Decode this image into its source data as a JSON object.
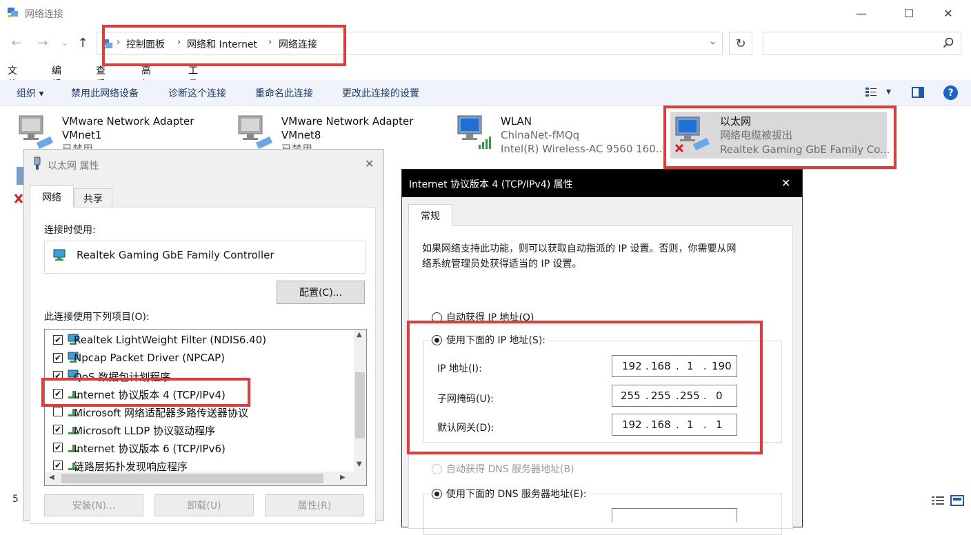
{
  "window": {
    "title": "网络连接",
    "controls": {
      "minimize": "—",
      "maximize": "☐",
      "close": "✕"
    }
  },
  "nav": {
    "back": "←",
    "forward": "→",
    "recent": "⌄",
    "up": "↑",
    "breadcrumbs": [
      "控制面板",
      "网络和 Internet",
      "网络连接"
    ],
    "dropdown": "⌄",
    "refresh": "↻",
    "search_placeholder": ""
  },
  "menubar": [
    "文件(F)",
    "编辑(E)",
    "查看(V)",
    "高级(N)",
    "工具(T)"
  ],
  "commandbar": {
    "organize": "组织 ▾",
    "commands": [
      "禁用此网络设备",
      "诊断这个连接",
      "重命名此连接",
      "更改此连接的设置"
    ],
    "view_dropdown": "▾",
    "help": "?"
  },
  "adapters": [
    {
      "name": "VMware Network Adapter",
      "name2": "VMnet1",
      "status": "已禁用",
      "device": ""
    },
    {
      "name": "VMware Network Adapter",
      "name2": "VMnet8",
      "status": "已禁用",
      "device": ""
    },
    {
      "name": "WLAN",
      "name2": "",
      "status": "ChinaNet-fMQq",
      "device": "Intel(R) Wireless-AC 9560 160..."
    },
    {
      "name": "以太网",
      "name2": "",
      "status": "网络电缆被拔出",
      "device": "Realtek Gaming GbE Family Co..."
    }
  ],
  "statusbar": {
    "count": "5"
  },
  "props_dialog": {
    "title": "以太网 属性",
    "close": "✕",
    "tabs": [
      "网络",
      "共享"
    ],
    "connect_using_label": "连接时使用:",
    "adapter_name": "Realtek Gaming GbE Family Controller",
    "configure_button": "配置(C)...",
    "items_label": "此连接使用下列项目(O):",
    "items": [
      {
        "label": "Realtek LightWeight Filter (NDIS6.40)",
        "checked": true
      },
      {
        "label": "Npcap Packet Driver (NPCAP)",
        "checked": true
      },
      {
        "label": "QoS 数据包计划程序",
        "checked": true
      },
      {
        "label": "Internet 协议版本 4 (TCP/IPv4)",
        "checked": true
      },
      {
        "label": "Microsoft 网络适配器多路传送器协议",
        "checked": false
      },
      {
        "label": "Microsoft LLDP 协议驱动程序",
        "checked": true
      },
      {
        "label": "Internet 协议版本 6 (TCP/IPv6)",
        "checked": true
      },
      {
        "label": "链路层拓扑发现响应程序",
        "checked": true
      }
    ],
    "buttons": [
      "安装(N)...",
      "卸载(U)",
      "属性(R)"
    ]
  },
  "ipv4_dialog": {
    "title": "Internet 协议版本 4 (TCP/IPv4) 属性",
    "close": "✕",
    "tab": "常规",
    "description_line1": "如果网络支持此功能，则可以获取自动指派的 IP 设置。否则，你需要从网",
    "description_line2": "络系统管理员处获得适当的 IP 设置。",
    "auto_ip": "自动获得 IP 地址(O)",
    "manual_ip": "使用下面的 IP 地址(S):",
    "ip_label": "IP 地址(I):",
    "mask_label": "子网掩码(U):",
    "gateway_label": "默认网关(D):",
    "ip": [
      "192",
      "168",
      "1",
      "190"
    ],
    "mask": [
      "255",
      "255",
      "255",
      "0"
    ],
    "gateway": [
      "192",
      "168",
      "1",
      "1"
    ],
    "auto_dns": "自动获得 DNS 服务器地址(B)",
    "manual_dns": "使用下面的 DNS 服务器地址(E):"
  },
  "colors": {
    "highlight_red": "#e63a3a",
    "cmdbar_bg": "#f0f4fa",
    "selected_bg": "#d9d9d9"
  }
}
